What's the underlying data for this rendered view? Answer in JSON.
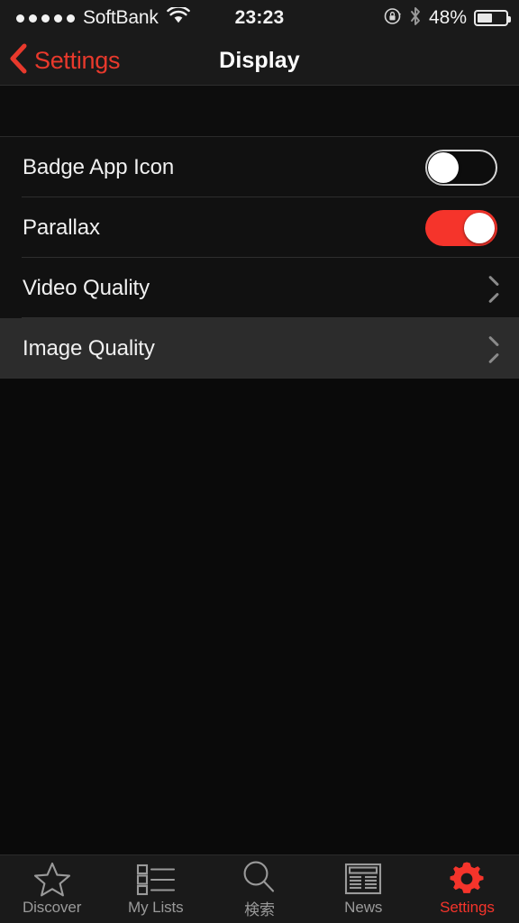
{
  "status_bar": {
    "signal_dots": 5,
    "carrier": "SoftBank",
    "wifi_icon": "wifi-icon",
    "time": "23:23",
    "rotation_lock_icon": "rotation-lock-icon",
    "bluetooth_icon": "bluetooth-icon",
    "battery_percent": "48%",
    "battery_level": 48
  },
  "nav_bar": {
    "back_icon": "chevron-left-icon",
    "back_label": "Settings",
    "title": "Display",
    "accent_color": "#e8392c"
  },
  "settings_rows": [
    {
      "label": "Badge App Icon",
      "type": "toggle",
      "value": "off"
    },
    {
      "label": "Parallax",
      "type": "toggle",
      "value": "on"
    },
    {
      "label": "Video Quality",
      "type": "disclosure",
      "highlighted": false
    },
    {
      "label": "Image Quality",
      "type": "disclosure",
      "highlighted": true
    }
  ],
  "tab_bar": {
    "tabs": [
      {
        "label": "Discover",
        "icon": "star-icon",
        "active": false
      },
      {
        "label": "My Lists",
        "icon": "list-icon",
        "active": false
      },
      {
        "label": "検索",
        "icon": "search-icon",
        "active": false
      },
      {
        "label": "News",
        "icon": "newspaper-icon",
        "active": false
      },
      {
        "label": "Settings",
        "icon": "gear-icon",
        "active": true
      }
    ],
    "active_color": "#f5342b",
    "inactive_color": "#9a9a9a"
  }
}
